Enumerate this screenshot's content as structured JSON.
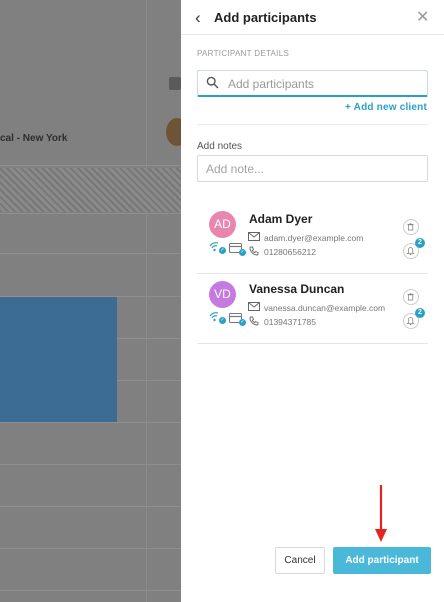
{
  "background": {
    "location_label": "cal - New York"
  },
  "drawer": {
    "title": "Add participants",
    "section_label": "PARTICIPANT DETAILS",
    "search_placeholder": "Add participants",
    "add_new_client": "+ Add new client",
    "notes_label": "Add notes",
    "notes_placeholder": "Add note...",
    "participants": [
      {
        "initials": "AD",
        "name": "Adam Dyer",
        "email": "adam.dyer@example.com",
        "phone": "01280656212",
        "avatar_color": "#e886b0",
        "notification_count": "2"
      },
      {
        "initials": "VD",
        "name": "Vanessa Duncan",
        "email": "vanessa.duncan@example.com",
        "phone": "01394371785",
        "avatar_color": "#c47ae0",
        "notification_count": "2"
      }
    ],
    "cancel_label": "Cancel",
    "submit_label": "Add participant",
    "accent_color": "#29a1c7"
  }
}
